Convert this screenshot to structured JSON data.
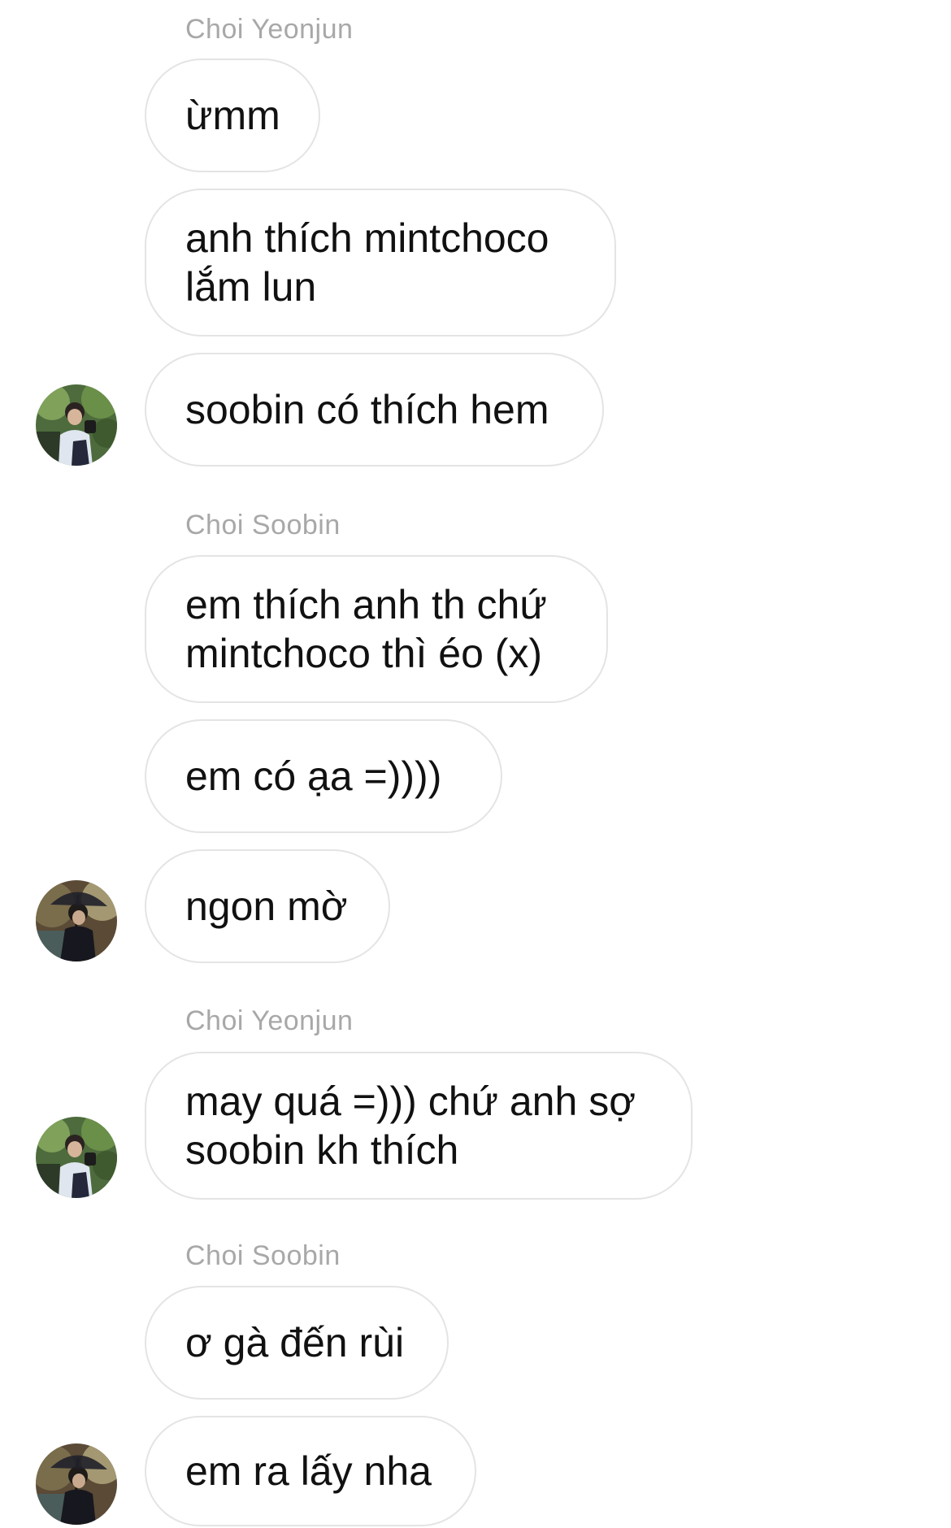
{
  "conversation": {
    "sender_yeonjun": "Choi Yeonjun",
    "sender_soobin": "Choi Soobin",
    "messages": [
      "ừmm",
      "anh thích mintchoco\nlắm lun",
      "soobin có thích hem",
      "em thích anh th chứ\nmintchoco thì éo (x)",
      "em có ạa =))))",
      "ngon mờ",
      "may quá =))) chứ anh sợ\nsoobin kh thích",
      "ơ gà đến rùi",
      "em ra lấy nha"
    ],
    "avatars": {
      "yeonjun": "yeonjun-avatar",
      "soobin": "soobin-avatar"
    }
  },
  "colors": {
    "bubble_border": "#e4e4e4",
    "sender_label": "#a8a8a8",
    "message_text": "#111111",
    "background": "#ffffff"
  }
}
